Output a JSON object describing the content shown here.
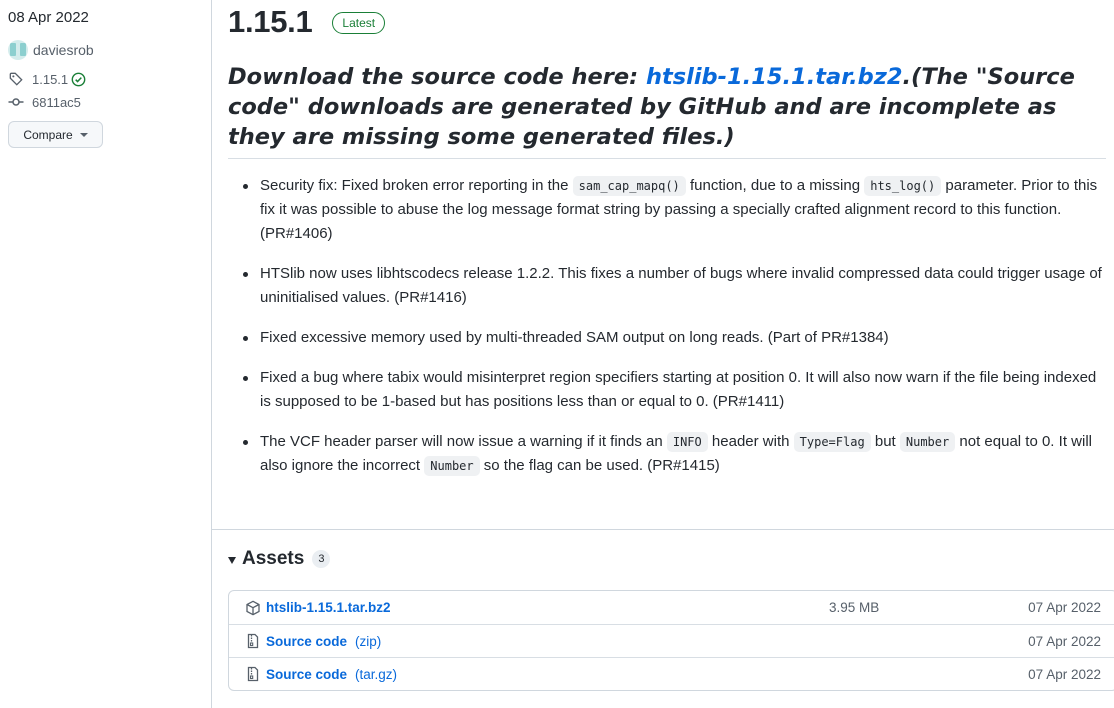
{
  "sidebar": {
    "date": "08 Apr 2022",
    "author": "daviesrob",
    "tag": "1.15.1",
    "commit": "6811ac5",
    "compare_label": "Compare"
  },
  "release": {
    "version": "1.15.1",
    "badge": "Latest",
    "headline": {
      "prefix": "Download the source code here: ",
      "link": "htslib-1.15.1.tar.bz2",
      "suffix": ".(The \"Source code\" downloads are generated by GitHub and are incomplete as they are missing some generated files.)"
    },
    "notes": [
      {
        "t1": "Security fix: Fixed broken error reporting in the ",
        "c1": "sam_cap_mapq()",
        "t2": " function, due to a missing ",
        "c2": "hts_log()",
        "t3": " parameter. Prior to this fix it was possible to abuse the log message format string by passing a specially crafted alignment record to this function. (PR#1406)"
      },
      {
        "t1": "HTSlib now uses libhtscodecs release 1.2.2. This fixes a number of bugs where invalid compressed data could trigger usage of uninitialised values. (PR#1416)"
      },
      {
        "t1": "Fixed excessive memory used by multi-threaded SAM output on long reads. (Part of PR#1384)"
      },
      {
        "t1": "Fixed a bug where tabix would misinterpret region specifiers starting at position 0. It will also now warn if the file being indexed is supposed to be 1-based but has positions less than or equal to 0. (PR#1411)"
      },
      {
        "t1": "The VCF header parser will now issue a warning if it finds an ",
        "c1": "INFO",
        "t2": " header with ",
        "c2": "Type=Flag",
        "t3": " but ",
        "c3": "Number",
        "t4": " not equal to 0. It will also ignore the incorrect ",
        "c4": "Number",
        "t5": " so the flag can be used. (PR#1415)"
      }
    ]
  },
  "assets": {
    "title": "Assets",
    "count": "3",
    "items": [
      {
        "name": "htslib-1.15.1.tar.bz2",
        "kind": "",
        "size": "3.95 MB",
        "date": "07 Apr 2022",
        "icon": "package-icon"
      },
      {
        "name": "Source code",
        "kind": "(zip)",
        "size": "",
        "date": "07 Apr 2022",
        "icon": "file-zip-icon"
      },
      {
        "name": "Source code",
        "kind": "(tar.gz)",
        "size": "",
        "date": "07 Apr 2022",
        "icon": "file-zip-icon"
      }
    ]
  },
  "colors": {
    "link": "#0969da",
    "success": "#1a7f37",
    "border": "#d0d7de",
    "text": "#24292f",
    "muted": "#57606a"
  }
}
